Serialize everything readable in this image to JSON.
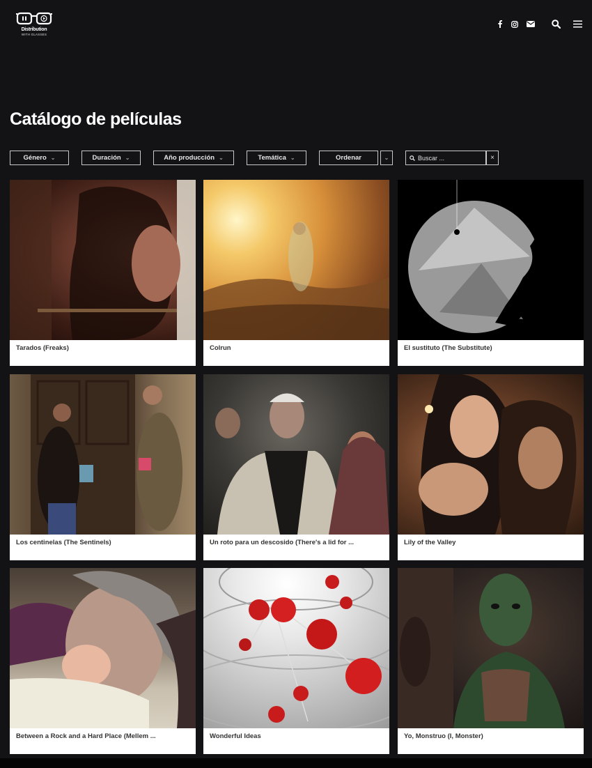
{
  "header": {
    "logo_line1": "Distribution",
    "logo_line2": "WITH GLASSES",
    "icons": [
      "facebook-icon",
      "instagram-icon",
      "mail-icon",
      "search-icon",
      "menu-icon"
    ]
  },
  "page_title": "Catálogo de películas",
  "filters": {
    "genero": "Género",
    "duracion": "Duración",
    "ano": "Año producción",
    "tematica": "Temática",
    "ordenar": "Ordenar",
    "search_placeholder": "Buscar ...",
    "clear": "×"
  },
  "films": [
    {
      "title": "Tarados (Freaks)"
    },
    {
      "title": "Colrun"
    },
    {
      "title": "El sustituto (The Substitute)"
    },
    {
      "title": "Los centinelas (The Sentinels)"
    },
    {
      "title": "Un roto para un descosido (There's a lid for ..."
    },
    {
      "title": "Lily of the Valley"
    },
    {
      "title": "Between a Rock and a Hard Place (Mellem ..."
    },
    {
      "title": "Wonderful Ideas"
    },
    {
      "title": "Yo, Monstruo (I, Monster)"
    }
  ],
  "colors": {
    "background": "#131316",
    "card_bg": "#ffffff",
    "caption_text": "#333333"
  }
}
